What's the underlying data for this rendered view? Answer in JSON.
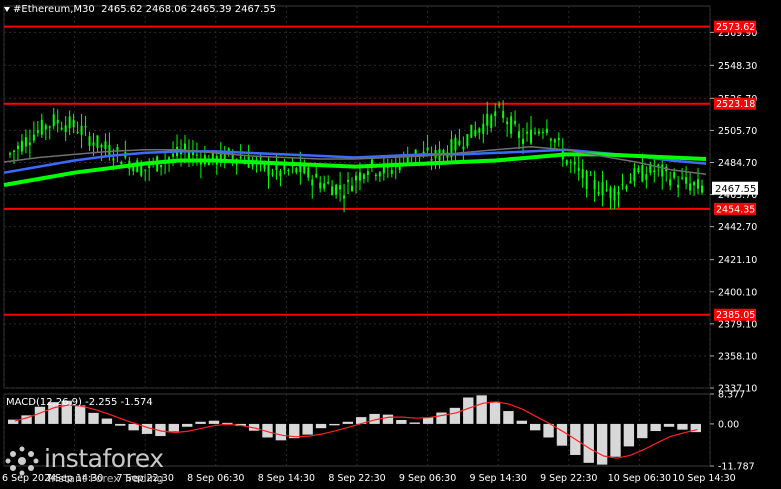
{
  "header": {
    "symbol": "#Ethereum,M30",
    "ohlc": "2465.62 2468.06 2465.39 2467.55"
  },
  "colors": {
    "background": "#000000",
    "grid": "#2a2a2a",
    "candle": "#00ff00",
    "level_line": "#ff0000",
    "ma_fast": "#3b6bff",
    "ma_slow": "#00ff00",
    "ma_gray": "#707070",
    "macd_hist": "#d8d8d8",
    "macd_signal": "#ff2020",
    "axis_text": "#ffffff"
  },
  "logo": {
    "name": "instaforex",
    "tagline": "Instant Forex Trading",
    "icon": "instaforex-logo-icon"
  },
  "chart_data": [
    {
      "type": "candlestick",
      "title": "#Ethereum,M30",
      "ylim": [
        2337.1,
        2587.14
      ],
      "y_ticks": [
        "2569.90",
        "2548.30",
        "2526.70",
        "2505.70",
        "2484.70",
        "2463.70",
        "2442.70",
        "2421.10",
        "2400.10",
        "2379.10",
        "2358.10",
        "2337.10"
      ],
      "current_price": "2467.55",
      "levels": [
        {
          "value": 2573.62,
          "label": "2573.62"
        },
        {
          "value": 2523.18,
          "label": "2523.18"
        },
        {
          "value": 2454.35,
          "label": "2454.35"
        },
        {
          "value": 2385.05,
          "label": "2385.05"
        }
      ],
      "ma_series": [
        {
          "color_key": "ma_fast",
          "values": [
            2478,
            2482,
            2486,
            2489,
            2491,
            2492,
            2492,
            2491,
            2490,
            2489,
            2488,
            2489,
            2490,
            2490,
            2491,
            2492,
            2493,
            2491,
            2489,
            2486,
            2484
          ]
        },
        {
          "color_key": "ma_slow",
          "values": [
            2470,
            2474,
            2478,
            2481,
            2484,
            2486,
            2486,
            2485,
            2484,
            2483,
            2482,
            2483,
            2484,
            2485,
            2486,
            2488,
            2490,
            2490,
            2489,
            2488,
            2487
          ]
        },
        {
          "color_key": "ma_gray",
          "values": [
            2485,
            2488,
            2490,
            2492,
            2493,
            2493,
            2491,
            2489,
            2488,
            2487,
            2487,
            2488,
            2489,
            2491,
            2493,
            2495,
            2493,
            2489,
            2485,
            2480,
            2477
          ]
        }
      ],
      "close_path": [
        2490,
        2503,
        2512,
        2508,
        2496,
        2489,
        2480,
        2487,
        2492,
        2486,
        2490,
        2484,
        2478,
        2480,
        2471,
        2467,
        2482,
        2479,
        2491,
        2488,
        2496,
        2507,
        2518,
        2499,
        2510,
        2485,
        2471,
        2465,
        2476,
        2480,
        2472,
        2468
      ]
    },
    {
      "type": "macd",
      "title": "MACD(12,26,9) -2.255 -1.574",
      "ylim": [
        -11.787,
        8.377
      ],
      "y_ticks": [
        "8.377",
        "0.00",
        "-11.787"
      ],
      "histogram": [
        1.2,
        2.4,
        4.8,
        6.1,
        6.5,
        5.2,
        3.1,
        1.5,
        -0.5,
        -1.8,
        -2.8,
        -3.4,
        -2.1,
        -0.8,
        0.6,
        0.9,
        0.3,
        -0.6,
        -1.9,
        -3.8,
        -4.6,
        -4.0,
        -3.0,
        -1.2,
        -0.4,
        0.6,
        1.9,
        2.8,
        2.6,
        1.1,
        0.4,
        1.8,
        3.2,
        4.5,
        7.4,
        8.0,
        6.2,
        3.6,
        0.9,
        -1.8,
        -3.8,
        -6.1,
        -8.7,
        -10.9,
        -11.4,
        -9.2,
        -6.3,
        -4.0,
        -2.0,
        -0.8,
        -1.6,
        -2.3
      ],
      "signal": [
        0.8,
        1.8,
        3.2,
        4.6,
        5.3,
        5.0,
        4.0,
        2.8,
        1.4,
        0.1,
        -1.1,
        -2.0,
        -2.4,
        -2.0,
        -1.2,
        -0.4,
        -0.1,
        -0.5,
        -1.2,
        -2.3,
        -3.2,
        -3.6,
        -3.4,
        -2.8,
        -1.9,
        -0.9,
        0.2,
        1.2,
        1.9,
        1.9,
        1.6,
        1.8,
        2.4,
        3.1,
        4.5,
        5.8,
        6.2,
        5.5,
        4.0,
        2.0,
        0.0,
        -2.2,
        -4.6,
        -7.0,
        -9.0,
        -9.6,
        -8.8,
        -7.2,
        -5.3,
        -3.5,
        -2.5,
        -1.6
      ]
    }
  ],
  "x_axis": {
    "labels": [
      "6 Sep 2024",
      "7 Sep 14:30",
      "7 Sep 22:30",
      "8 Sep 06:30",
      "8 Sep 14:30",
      "8 Sep 22:30",
      "9 Sep 06:30",
      "9 Sep 14:30",
      "9 Sep 22:30",
      "10 Sep 06:30",
      "10 Sep 14:30"
    ]
  }
}
